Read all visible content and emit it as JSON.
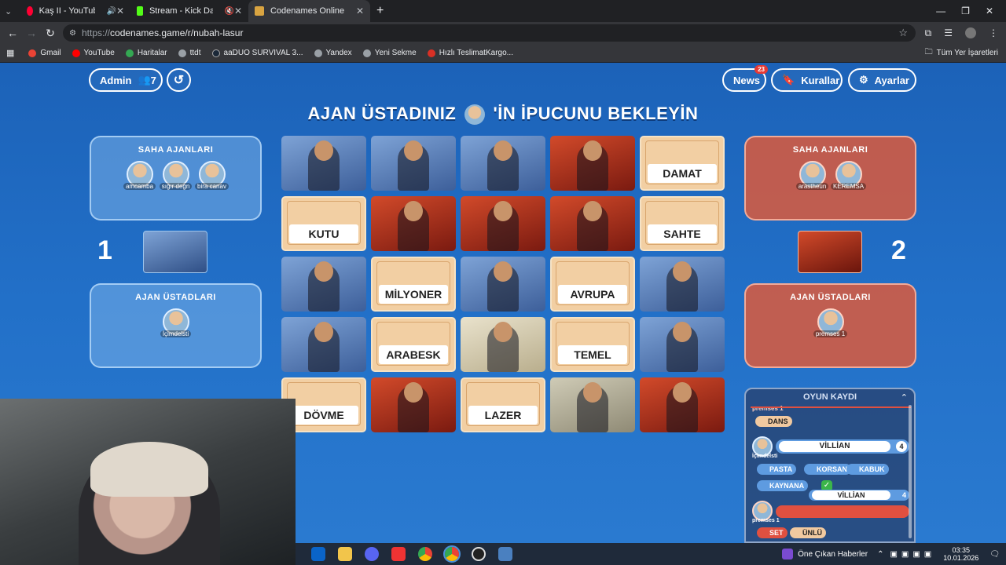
{
  "browser": {
    "tabs": [
      {
        "label": "Kaş II - YouTube Music",
        "color": "#ff0033",
        "active": false
      },
      {
        "label": "Stream - Kick Dashboard",
        "color": "#53fc18",
        "active": false
      },
      {
        "label": "Codenames Online",
        "color": "#d9a441",
        "active": true
      }
    ],
    "new_tab": "+",
    "url_prefix": "https://",
    "url": "codenames.game/r/nubah-lasur",
    "bookmarks": [
      "Gmail",
      "YouTube",
      "Haritalar",
      "ttdt",
      "aaDUO SURVIVAL 3...",
      "Yandex",
      "Yeni Sekme",
      "Hızlı TeslimatKargo..."
    ],
    "all_bookmarks": "Tüm Yer İşaretleri"
  },
  "game": {
    "admin_label": "Admin",
    "player_count": "7",
    "news_label": "News",
    "news_badge": "23",
    "rules_label": "Kurallar",
    "settings_label": "Ayarlar",
    "headline_left": "AJAN ÜSTADINIZ",
    "headline_right": "'İN İPUCUNU BEKLEYİN",
    "blue_team": {
      "operatives_title": "SAHA AJANLARI",
      "operatives": [
        "amcamba",
        "sığır değn",
        "bira canav"
      ],
      "score": "1",
      "spymasters_title": "AJAN ÜSTADLARI",
      "spymasters": [
        "İçimdelsti"
      ]
    },
    "red_team": {
      "operatives_title": "SAHA AJANLARI",
      "operatives": [
        "arastheun",
        "KEREMSA"
      ],
      "score": "2",
      "spymasters_title": "AJAN ÜSTADLARI",
      "spymasters": [
        "premses 1"
      ]
    },
    "cards": [
      {
        "type": "blue",
        "word": ""
      },
      {
        "type": "blue",
        "word": ""
      },
      {
        "type": "blue",
        "word": ""
      },
      {
        "type": "red",
        "word": ""
      },
      {
        "type": "word",
        "word": "DAMAT"
      },
      {
        "type": "word",
        "word": "KUTU"
      },
      {
        "type": "red",
        "word": ""
      },
      {
        "type": "red",
        "word": ""
      },
      {
        "type": "red",
        "word": ""
      },
      {
        "type": "word",
        "word": "SAHTE"
      },
      {
        "type": "blue",
        "word": ""
      },
      {
        "type": "word",
        "word": "MİLYONER"
      },
      {
        "type": "blue",
        "word": ""
      },
      {
        "type": "word",
        "word": "AVRUPA"
      },
      {
        "type": "blue",
        "word": ""
      },
      {
        "type": "blue",
        "word": ""
      },
      {
        "type": "word",
        "word": "ARABESK"
      },
      {
        "type": "neutral",
        "word": ""
      },
      {
        "type": "word",
        "word": "TEMEL"
      },
      {
        "type": "blue",
        "word": ""
      },
      {
        "type": "word",
        "word": "DÖVME"
      },
      {
        "type": "red",
        "word": ""
      },
      {
        "type": "word",
        "word": "LAZER"
      },
      {
        "type": "assassin",
        "word": ""
      },
      {
        "type": "red",
        "word": ""
      }
    ],
    "log": {
      "title": "OYUN KAYDI",
      "top_user": "premses 1",
      "first_chip": "DANS",
      "clue_user": "İçimdelsti",
      "clue": "VİLLİAN",
      "clue_count": "4",
      "guesses": [
        "PASTA",
        "KORSAN",
        "KABUK",
        "KAYNANA"
      ],
      "clue2": "VİLLİAN",
      "clue2_count": "4",
      "last_user": "premses 1",
      "last_chips": [
        "SET",
        "ÜNLÜ"
      ]
    }
  },
  "taskbar": {
    "news_label": "Öne Çıkan Haberler",
    "time": "03:35",
    "date": "10.01.2026"
  }
}
